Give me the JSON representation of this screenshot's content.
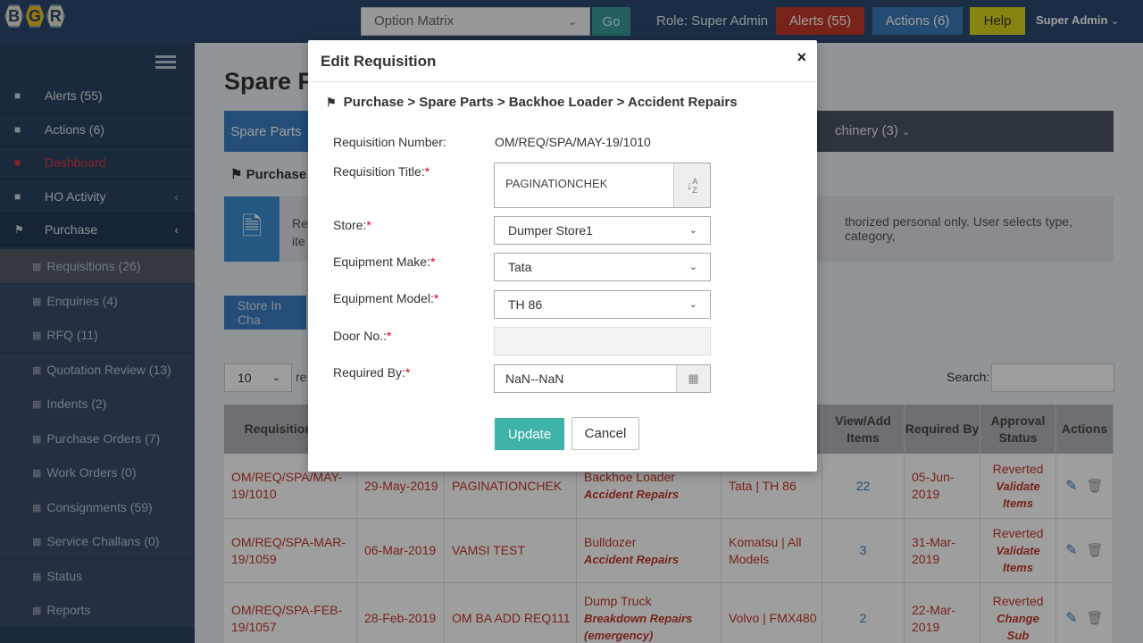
{
  "app": {
    "logo_letters": [
      "B",
      "G",
      "R"
    ],
    "option_matrix": "Option Matrix",
    "go_label": "Go",
    "role": "Role: Super Admin",
    "alerts_label": "Alerts (55)",
    "actions_label": "Actions (6)",
    "help_label": "Help",
    "user_label": "Super Admin"
  },
  "sidebar": {
    "items": [
      {
        "label": "Alerts (55)",
        "icon": "area-chart-icon"
      },
      {
        "label": "Actions (6)",
        "icon": "area-chart-icon"
      },
      {
        "label": "Dashboard",
        "icon": "area-chart-icon"
      },
      {
        "label": "HO Activity",
        "icon": "area-chart-icon"
      },
      {
        "label": "Purchase",
        "icon": "flag-icon"
      }
    ],
    "subitems": [
      "Requisitions (26)",
      "Enquiries (4)",
      "RFQ (11)",
      "Quotation Review (13)",
      "Indents (2)",
      "Purchase Orders (7)",
      "Work Orders (0)",
      "Consignments (59)",
      "Service Challans (0)",
      "Status",
      "Reports"
    ]
  },
  "main": {
    "page_title": "Spare Parts",
    "tab_active": "Spare Parts",
    "tab_machinery": "chinery (3)",
    "purchase_crumb": "Purchase",
    "info_line1": "Re",
    "info_line2": "ite",
    "info_right": "thorized personal only. User selects type, category,",
    "store_btn": "Store In Cha",
    "page_len": "10",
    "page_len_suffix": "re",
    "search_label": "Search:"
  },
  "table": {
    "headers": [
      "Requisition No.",
      "",
      "",
      "",
      "",
      "View/Add Items",
      "Required By",
      "Approval Status",
      "Actions"
    ],
    "rows": [
      {
        "req_no": "OM/REQ/SPA/MAY-19/1010",
        "date": "29-May-2019",
        "title": "PAGINATIONCHEK",
        "equip": "Backhoe Loader",
        "reason": "Accident Repairs",
        "make": "Tata | TH 86",
        "items": "22",
        "required": "05-Jun-2019",
        "status1": "Reverted",
        "status2": "Validate",
        "status3": "Items"
      },
      {
        "req_no": "OM/REQ/SPA-MAR-19/1059",
        "date": "06-Mar-2019",
        "title": "VAMSI TEST",
        "equip": "Bulldozer",
        "reason": "Accident Repairs",
        "make": "Komatsu | All Models",
        "items": "3",
        "required": "31-Mar-2019",
        "status1": "Reverted",
        "status2": "Validate",
        "status3": "Items"
      },
      {
        "req_no": "OM/REQ/SPA-FEB-19/1057",
        "date": "28-Feb-2019",
        "title": "OM BA ADD REQ111",
        "equip": "Dump Truck",
        "reason": "Breakdown Repairs (emergency)",
        "make": "Volvo | FMX480",
        "items": "2",
        "required": "22-Mar-2019",
        "status1": "Reverted",
        "status2": "Change",
        "status3": "Sub"
      }
    ]
  },
  "modal": {
    "title": "Edit Requisition",
    "close": "×",
    "breadcrumb": "Purchase > Spare Parts > Backhoe Loader > Accident Repairs",
    "fields": {
      "req_number_label": "Requisition Number:",
      "req_number_value": "OM/REQ/SPA/MAY-19/1010",
      "title_label": "Requisition Title:",
      "title_value": "PAGINATIONCHEK",
      "store_label": "Store:",
      "store_value": "Dumper Store1",
      "make_label": "Equipment Make:",
      "make_value": "Tata",
      "model_label": "Equipment Model:",
      "model_value": "TH 86",
      "door_label": "Door No.:",
      "door_value": "",
      "required_label": "Required By:",
      "required_value": "NaN--NaN"
    },
    "update_label": "Update",
    "cancel_label": "Cancel"
  },
  "colors": {
    "topbar": "#2d4a6e",
    "sidebar": "#2c4361",
    "alerts": "#c0392b",
    "actions": "#3b79b7",
    "help": "#dcd31c",
    "update": "#3fb3a8"
  }
}
